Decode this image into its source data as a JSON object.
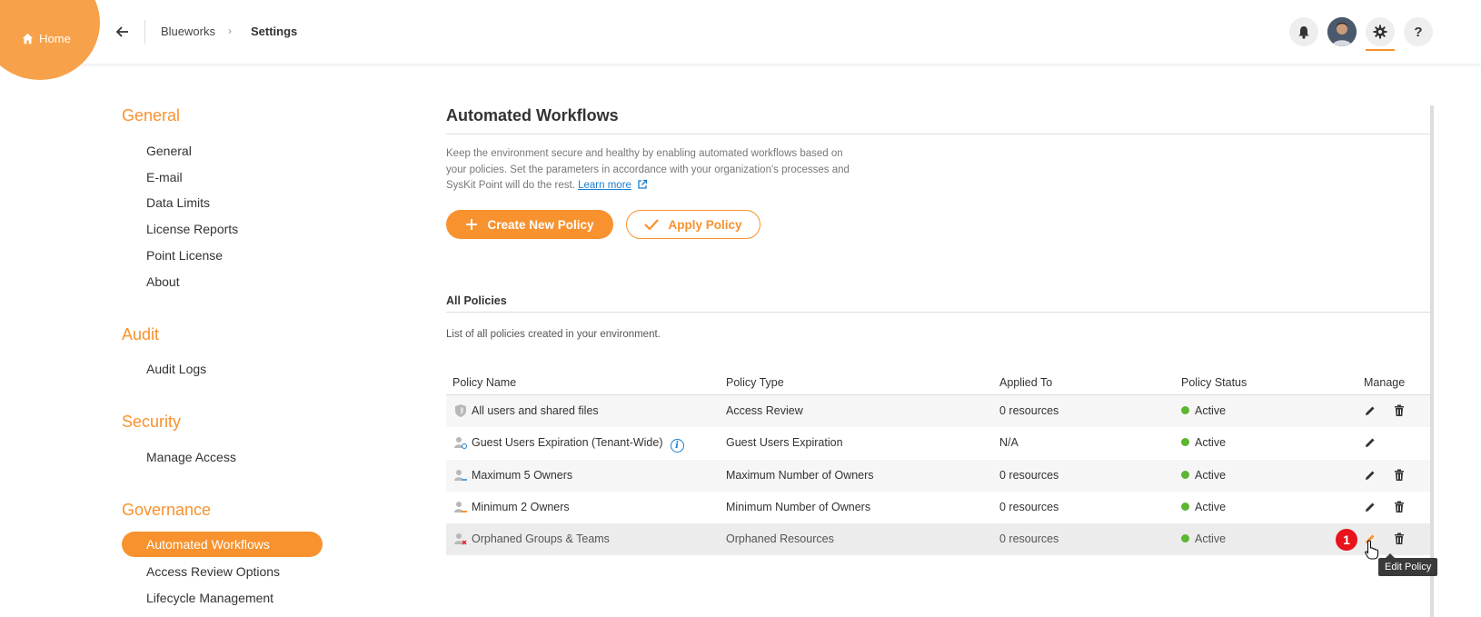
{
  "header": {
    "home_label": "Home",
    "breadcrumb": [
      "Blueworks",
      "Settings"
    ],
    "icons": [
      "bell-icon",
      "avatar",
      "gear-icon",
      "help-icon"
    ],
    "help_glyph": "?"
  },
  "sidebar": {
    "sections": [
      {
        "title": "General",
        "items": [
          "General",
          "E-mail",
          "Data Limits",
          "License Reports",
          "Point License",
          "About"
        ]
      },
      {
        "title": "Audit",
        "items": [
          "Audit Logs"
        ]
      },
      {
        "title": "Security",
        "items": [
          "Manage Access"
        ]
      },
      {
        "title": "Governance",
        "items": [
          "Automated Workflows",
          "Access Review Options",
          "Lifecycle Management"
        ]
      }
    ],
    "active_item": "Automated Workflows"
  },
  "main": {
    "title": "Automated Workflows",
    "description": "Keep the environment secure and healthy by enabling automated workflows based on your policies. Set the parameters in accordance with your organization's processes and SysKit Point will do the rest.",
    "learn_more": "Learn more",
    "create_button": "Create New Policy",
    "apply_button": "Apply Policy",
    "section_title": "All Policies",
    "section_desc": "List of all policies created in your environment.",
    "table": {
      "headers": [
        "Policy Name",
        "Policy Type",
        "Applied To",
        "Policy Status",
        "Manage"
      ],
      "rows": [
        {
          "name": "All users and shared files",
          "type": "Access Review",
          "applied": "0 resources",
          "status": "Active"
        },
        {
          "name": "Guest Users Expiration (Tenant-Wide)",
          "type": "Guest Users Expiration",
          "applied": "N/A",
          "status": "Active"
        },
        {
          "name": "Maximum 5 Owners",
          "type": "Maximum Number of Owners",
          "applied": "0 resources",
          "status": "Active"
        },
        {
          "name": "Minimum 2 Owners",
          "type": "Minimum Number of Owners",
          "applied": "0 resources",
          "status": "Active"
        },
        {
          "name": "Orphaned Groups & Teams",
          "type": "Orphaned Resources",
          "applied": "0 resources",
          "status": "Active"
        }
      ]
    },
    "marker": "1",
    "tooltip": "Edit Policy"
  },
  "colors": {
    "accent": "#F7922E",
    "status_active": "#5cb630",
    "link": "#1a7fd0",
    "marker": "#e8131b"
  }
}
